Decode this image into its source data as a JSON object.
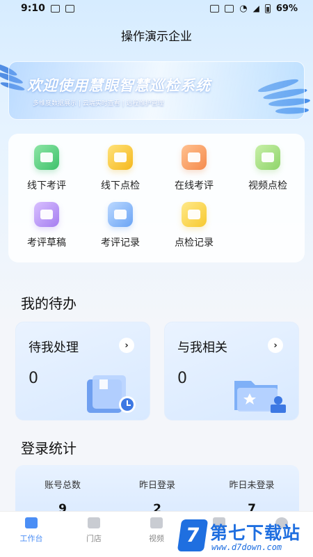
{
  "status_bar": {
    "time": "9:10",
    "battery": "69%"
  },
  "header": {
    "title": "操作演示企业"
  },
  "banner": {
    "title": "欢迎使用慧眼智慧巡检系统",
    "subtitle": "多维度数据展示 | 云端实时查看 | 远程维护管理"
  },
  "functions": [
    {
      "label": "线下考评",
      "icon": "checklist-icon",
      "color": "#3ec16b"
    },
    {
      "label": "线下点检",
      "icon": "store-icon",
      "color": "#f5b81d"
    },
    {
      "label": "在线考评",
      "icon": "video-camera-icon",
      "color": "#f58a4c"
    },
    {
      "label": "视频点检",
      "icon": "video-play-icon",
      "color": "#8fd46a"
    },
    {
      "label": "考评草稿",
      "icon": "draft-box-icon",
      "color": "#a57df0"
    },
    {
      "label": "考评记录",
      "icon": "edit-record-icon",
      "color": "#6aa4f5"
    },
    {
      "label": "点检记录",
      "icon": "record-list-icon",
      "color": "#f7c92f"
    }
  ],
  "todo": {
    "section_title": "我的待办",
    "cards": [
      {
        "title": "待我处理",
        "count": "0",
        "chevron": "›"
      },
      {
        "title": "与我相关",
        "count": "0",
        "chevron": "›"
      }
    ]
  },
  "login_stats": {
    "section_title": "登录统计",
    "items": [
      {
        "label": "账号总数",
        "value": "9"
      },
      {
        "label": "昨日登录",
        "value": "2"
      },
      {
        "label": "昨日未登录",
        "value": "7"
      }
    ]
  },
  "bottom_nav": {
    "items": [
      {
        "label": "工作台",
        "active": true
      },
      {
        "label": "门店",
        "active": false
      },
      {
        "label": "视频",
        "active": false
      },
      {
        "label": "",
        "active": false
      },
      {
        "label": "",
        "active": false
      }
    ]
  },
  "watermark": {
    "badge": "7",
    "text": "第七下载站",
    "url": "www.d7down.com"
  },
  "colors": {
    "accent": "#4b8ef5",
    "watermark": "#1f6fe0"
  }
}
